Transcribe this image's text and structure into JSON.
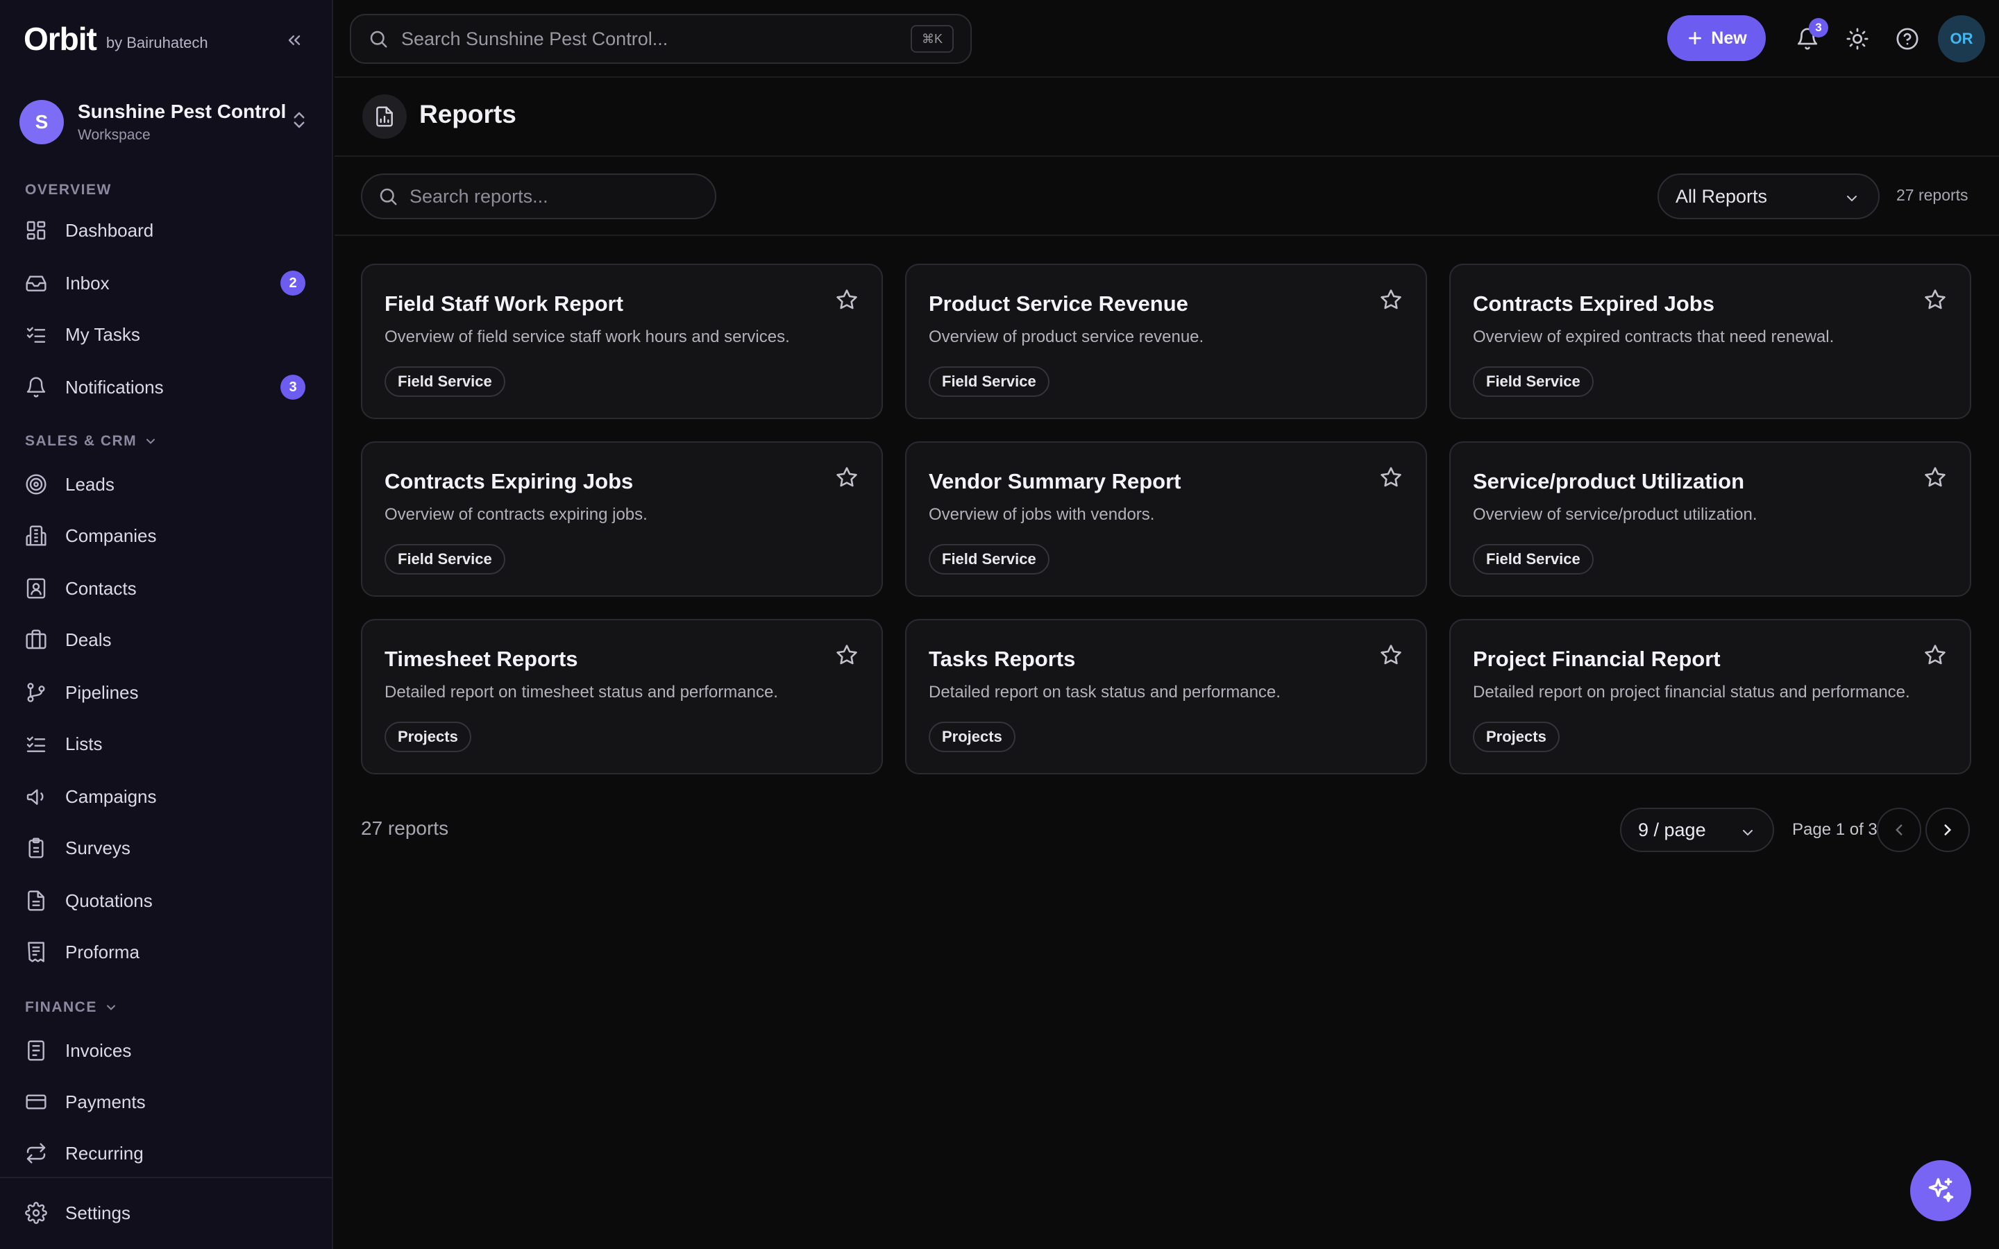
{
  "brand": {
    "logo": "Orbit",
    "byline": "by Bairuhatech"
  },
  "workspace": {
    "initial": "S",
    "name": "Sunshine Pest Control",
    "subtitle": "Workspace"
  },
  "sidebar": {
    "sections": {
      "overview": "OVERVIEW",
      "sales": "SALES & CRM",
      "finance": "FINANCE"
    },
    "overview_items": [
      {
        "label": "Dashboard",
        "icon": "dashboard-icon"
      },
      {
        "label": "Inbox",
        "icon": "inbox-icon",
        "badge": "2"
      },
      {
        "label": "My Tasks",
        "icon": "tasks-icon"
      },
      {
        "label": "Notifications",
        "icon": "bell-icon",
        "badge": "3"
      }
    ],
    "sales_items": [
      {
        "label": "Leads",
        "icon": "target-icon"
      },
      {
        "label": "Companies",
        "icon": "building-icon"
      },
      {
        "label": "Contacts",
        "icon": "contact-icon"
      },
      {
        "label": "Deals",
        "icon": "briefcase-icon"
      },
      {
        "label": "Pipelines",
        "icon": "pipeline-icon"
      },
      {
        "label": "Lists",
        "icon": "list-icon"
      },
      {
        "label": "Campaigns",
        "icon": "megaphone-icon"
      },
      {
        "label": "Surveys",
        "icon": "clipboard-icon"
      },
      {
        "label": "Quotations",
        "icon": "document-icon"
      },
      {
        "label": "Proforma",
        "icon": "receipt-icon"
      }
    ],
    "finance_items": [
      {
        "label": "Invoices",
        "icon": "invoice-icon"
      },
      {
        "label": "Payments",
        "icon": "card-icon"
      },
      {
        "label": "Recurring",
        "icon": "repeat-icon"
      }
    ],
    "settings": {
      "label": "Settings",
      "icon": "gear-icon"
    }
  },
  "topbar": {
    "search_placeholder": "Search Sunshine Pest Control...",
    "shortcut": "⌘K",
    "new_label": "New",
    "notification_count": "3",
    "user_initials": "OR"
  },
  "page": {
    "title": "Reports",
    "search_placeholder": "Search reports...",
    "filter_value": "All Reports",
    "count_label": "27 reports"
  },
  "reports": [
    {
      "title": "Field Staff Work Report",
      "description": "Overview of field service staff work hours and services.",
      "tag": "Field Service"
    },
    {
      "title": "Product Service Revenue",
      "description": "Overview of product service revenue.",
      "tag": "Field Service"
    },
    {
      "title": "Contracts Expired Jobs",
      "description": "Overview of expired contracts that need renewal.",
      "tag": "Field Service"
    },
    {
      "title": "Contracts Expiring Jobs",
      "description": "Overview of contracts expiring jobs.",
      "tag": "Field Service"
    },
    {
      "title": "Vendor Summary Report",
      "description": "Overview of jobs with vendors.",
      "tag": "Field Service"
    },
    {
      "title": "Service/product Utilization",
      "description": "Overview of service/product utilization.",
      "tag": "Field Service"
    },
    {
      "title": "Timesheet Reports",
      "description": "Detailed report on timesheet status and performance.",
      "tag": "Projects"
    },
    {
      "title": "Tasks Reports",
      "description": "Detailed report on task status and performance.",
      "tag": "Projects"
    },
    {
      "title": "Project Financial Report",
      "description": "Detailed report on project financial status and performance.",
      "tag": "Projects"
    }
  ],
  "pagination": {
    "total_label": "27 reports",
    "page_size": "9 / page",
    "page_info": "Page 1 of 3"
  },
  "colors": {
    "accent": "#6d5cf0",
    "sidebar_bg": "#120f1d",
    "content_bg": "#0b0b0c",
    "card_bg": "#141417"
  }
}
